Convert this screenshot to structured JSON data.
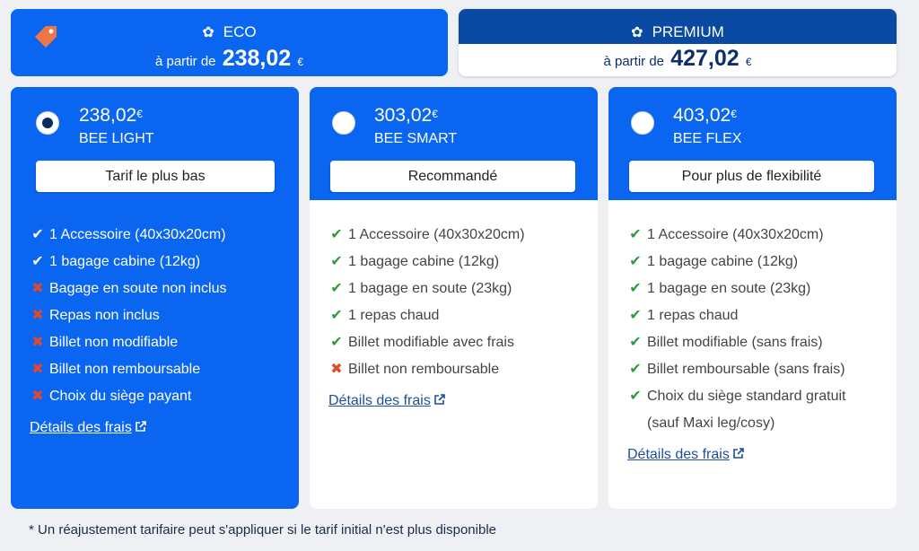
{
  "categories": {
    "eco": {
      "name": "ECO",
      "prefix": "à partir de",
      "price": "238,02",
      "currency": "€",
      "icon": "bee-icon",
      "badge_icon": "tag-icon"
    },
    "premium": {
      "name": "PREMIUM",
      "prefix": "à partir de",
      "price": "427,02",
      "currency": "€",
      "icon": "bee-icon"
    }
  },
  "plans": [
    {
      "price": "238,02",
      "currency": "€",
      "name": "BEE LIGHT",
      "badge": "Tarif le plus bas",
      "selected": true,
      "features": [
        {
          "type": "check",
          "text": "1 Accessoire (40x30x20cm)"
        },
        {
          "type": "check",
          "text": "1 bagage cabine (12kg)"
        },
        {
          "type": "cross",
          "text": "Bagage en soute non inclus"
        },
        {
          "type": "cross",
          "text": "Repas non inclus"
        },
        {
          "type": "cross",
          "text": "Billet non modifiable"
        },
        {
          "type": "cross",
          "text": "Billet non remboursable"
        },
        {
          "type": "cross",
          "text": "Choix du siège payant"
        }
      ],
      "details": "Détails des frais"
    },
    {
      "price": "303,02",
      "currency": "€",
      "name": "BEE SMART",
      "badge": "Recommandé",
      "selected": false,
      "features": [
        {
          "type": "check",
          "text": "1 Accessoire (40x30x20cm)"
        },
        {
          "type": "check",
          "text": "1 bagage cabine (12kg)"
        },
        {
          "type": "check",
          "text": "1 bagage en soute (23kg)"
        },
        {
          "type": "check",
          "text": "1 repas chaud"
        },
        {
          "type": "check",
          "text": "Billet modifiable avec frais"
        },
        {
          "type": "cross",
          "text": "Billet non remboursable"
        }
      ],
      "details": "Détails des frais"
    },
    {
      "price": "403,02",
      "currency": "€",
      "name": "BEE FLEX",
      "badge": "Pour plus de flexibilité",
      "selected": false,
      "features": [
        {
          "type": "check",
          "text": "1 Accessoire (40x30x20cm)"
        },
        {
          "type": "check",
          "text": "1 bagage cabine (12kg)"
        },
        {
          "type": "check",
          "text": "1 bagage en soute (23kg)"
        },
        {
          "type": "check",
          "text": "1 repas chaud"
        },
        {
          "type": "check",
          "text": "Billet modifiable (sans frais)"
        },
        {
          "type": "check",
          "text": "Billet remboursable (sans frais)"
        },
        {
          "type": "check",
          "text": "Choix du siège standard gratuit",
          "text2": "(sauf Maxi leg/cosy)"
        }
      ],
      "details": "Détails des frais"
    }
  ],
  "footnote": "* Un réajustement tarifaire peut s'appliquer si le tarif initial n'est plus disponible",
  "colors": {
    "primary_blue": "#0a66f0",
    "premium_blue": "#0b4aa2",
    "check_green": "#2e9b3e",
    "cross_red": "#e04a2a",
    "tag_orange": "#f0764a"
  }
}
